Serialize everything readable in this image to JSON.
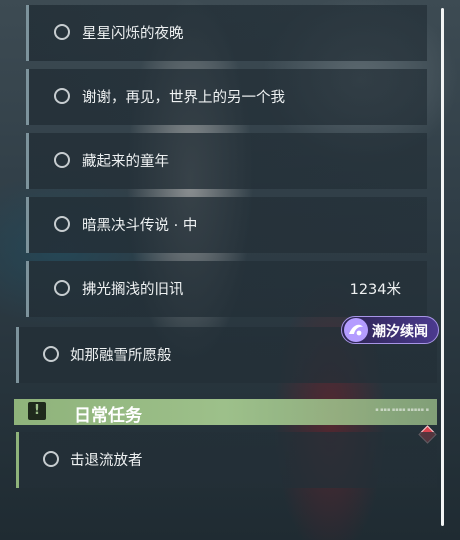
{
  "quests": [
    {
      "label": "星星闪烁的夜晚"
    },
    {
      "label": "谢谢，再见，世界上的另一个我"
    },
    {
      "label": "藏起来的童年"
    },
    {
      "label": "暗黑决斗传说 · 中"
    },
    {
      "label": "拂光搁浅的旧讯",
      "distance": "1234米"
    },
    {
      "label": "如那融雪所愿般"
    }
  ],
  "badge": {
    "text": "潮汐续闻",
    "icon": "tide-swirl-icon"
  },
  "daily": {
    "title": "日常任务",
    "icon": "exclamation-icon",
    "quests": [
      {
        "label": "击退流放者"
      }
    ]
  },
  "colors": {
    "accent_daily": "#9dc08a",
    "badge_purple": "#4b3a8f",
    "tracker_red": "#d94550"
  }
}
